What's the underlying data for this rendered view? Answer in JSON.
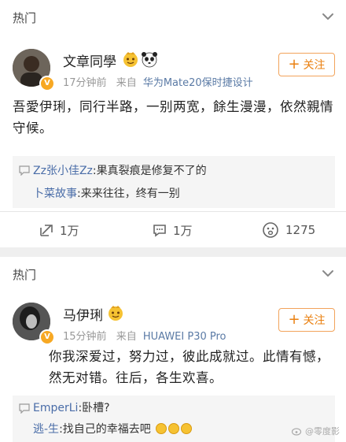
{
  "card1": {
    "section_title": "热门",
    "user": {
      "name": "文章同學"
    },
    "meta": {
      "time": "17分钟前",
      "source_prefix": "来自",
      "source": "华为Mate20保时捷设计"
    },
    "follow_label": "关注",
    "text": "吾愛伊琍，同行半路，一别两宽，餘生漫漫，依然親情守候。",
    "comments": [
      {
        "user": "Zz张小佳Zz",
        "text": ":果真裂痕是修复不了的"
      },
      {
        "user": "卜菜故事",
        "text": ":来来往往，终有一别"
      }
    ],
    "actions": {
      "repost": "1万",
      "comment": "1万",
      "like": "1275"
    }
  },
  "card2": {
    "section_title": "热门",
    "user": {
      "name": "马伊琍"
    },
    "meta": {
      "time": "15分钟前",
      "source_prefix": "来自",
      "source": "HUAWEI P30 Pro"
    },
    "follow_label": "关注",
    "text": "你我深爱过，努力过，彼此成就过。此情有憾，然无对错。往后，各生欢喜。",
    "comments": [
      {
        "user": "EmperLi",
        "text": ":卧槽?"
      },
      {
        "user": "逃-生",
        "text": ":找自己的幸福去吧"
      }
    ]
  },
  "watermark": "@零度影",
  "icons": {
    "chevron": "chevron-down-icon",
    "repost": "repost-icon",
    "comment": "comment-icon",
    "like": "like-icon",
    "verified": "verified-badge-icon"
  },
  "colors": {
    "accent": "#ea8010",
    "link": "#4a6da8",
    "source": "#5a7aa5"
  }
}
